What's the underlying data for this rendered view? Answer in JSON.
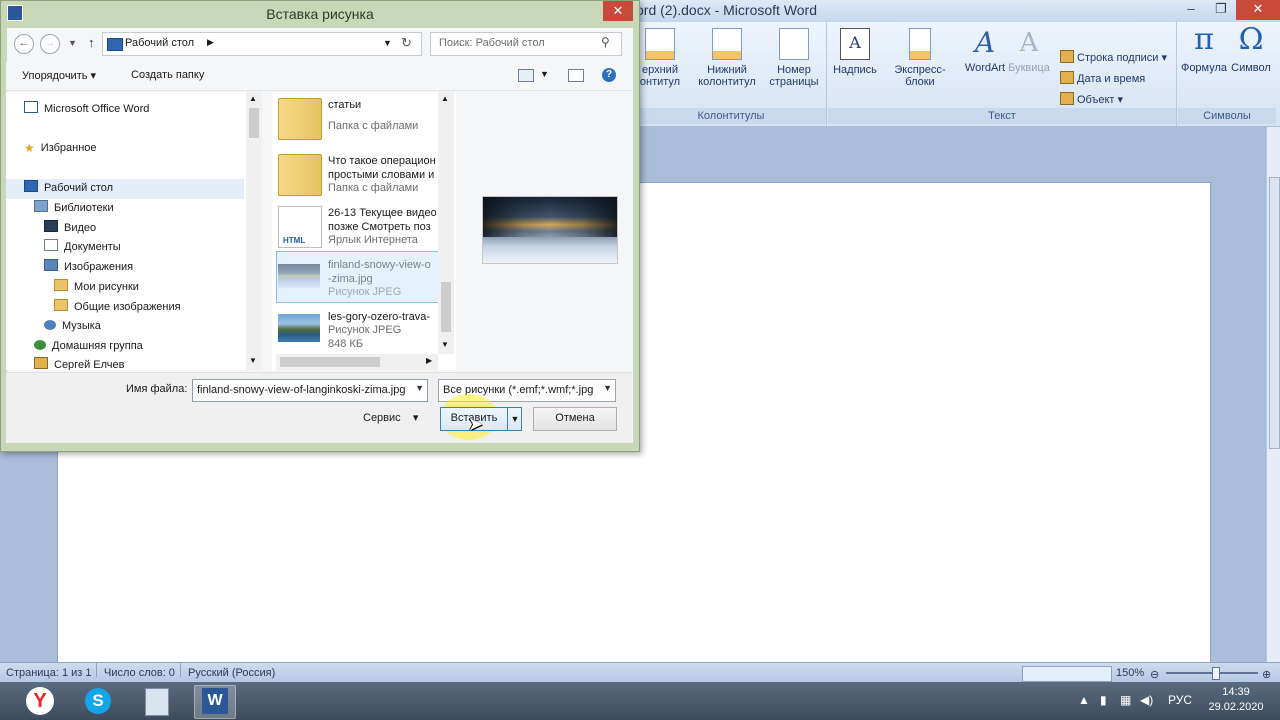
{
  "word": {
    "title": "ord (2).docx - Microsoft Word",
    "ribbon": {
      "groups": [
        {
          "label": "Колонтитулы",
          "buttons": [
            "Верхний колонтитул",
            "Нижний колонтитул",
            "Номер страницы"
          ]
        },
        {
          "label": "Текст",
          "buttons": [
            "Надпись",
            "Экспресс-блоки",
            "WordArt",
            "Буквица"
          ],
          "small": [
            "Строка подписи",
            "Дата и время",
            "Объект"
          ]
        },
        {
          "label": "Символы",
          "buttons": [
            "Формула",
            "Символ"
          ]
        }
      ],
      "header_btn_1": "ерхний",
      "header_btn_2": "онтитул",
      "footer_btn_1": "Нижний",
      "footer_btn_2": "колонтитул",
      "pagenum_btn_1": "Номер",
      "pagenum_btn_2": "страницы"
    },
    "statusbar": {
      "page": "Страница: 1 из 1",
      "words": "Число слов: 0",
      "lang": "Русский (Россия)",
      "zoom": "150%"
    }
  },
  "taskbar": {
    "apps": [
      "yandex-browser",
      "skype",
      "calculator",
      "word"
    ],
    "lang": "РУС",
    "time": "14:39",
    "date": "29.02.2020"
  },
  "dialog": {
    "title": "Вставка рисунка",
    "address": "Рабочий стол",
    "search_placeholder": "Поиск: Рабочий стол",
    "toolbar": {
      "organize": "Упорядочить",
      "new_folder": "Создать папку"
    },
    "nav": [
      {
        "label": "Microsoft Office Word",
        "icon": "word-icon"
      },
      {
        "label": "Избранное",
        "icon": "star-icon"
      },
      {
        "label": "Рабочий стол",
        "icon": "desktop-icon"
      },
      {
        "label": "Библиотеки",
        "icon": "library-icon"
      },
      {
        "label": "Видео",
        "icon": "video-icon"
      },
      {
        "label": "Документы",
        "icon": "documents-icon"
      },
      {
        "label": "Изображения",
        "icon": "images-icon"
      },
      {
        "label": "Мои рисунки",
        "icon": "folder-icon"
      },
      {
        "label": "Общие изображения",
        "icon": "folder-icon"
      },
      {
        "label": "Музыка",
        "icon": "music-icon"
      },
      {
        "label": "Домашняя группа",
        "icon": "homegroup-icon"
      },
      {
        "label": "Сергей Елчев",
        "icon": "user-icon"
      }
    ],
    "files": [
      {
        "name": "статьи",
        "kind": "Папка с файлами"
      },
      {
        "name": "Что такое операцион",
        "name2": "простыми словами и",
        "kind": "Папка с файлами"
      },
      {
        "name": "26-13 Текущее видео",
        "name2": "позже Смотреть поз",
        "kind": "Ярлык Интернета"
      },
      {
        "name": "finland-snowy-view-o",
        "name2": "-zima.jpg",
        "kind": "Рисунок JPEG"
      },
      {
        "name": "les-gory-ozero-trava-",
        "kind": "Рисунок JPEG",
        "size": "848 КБ"
      }
    ],
    "filename_label": "Имя файла:",
    "filename_value": "finland-snowy-view-of-langinkoski-zima.jpg",
    "filetype_value": "Все рисунки (*.emf;*.wmf;*.jpg",
    "service": "Сервис",
    "insert": "Вставить",
    "cancel": "Отмена"
  }
}
